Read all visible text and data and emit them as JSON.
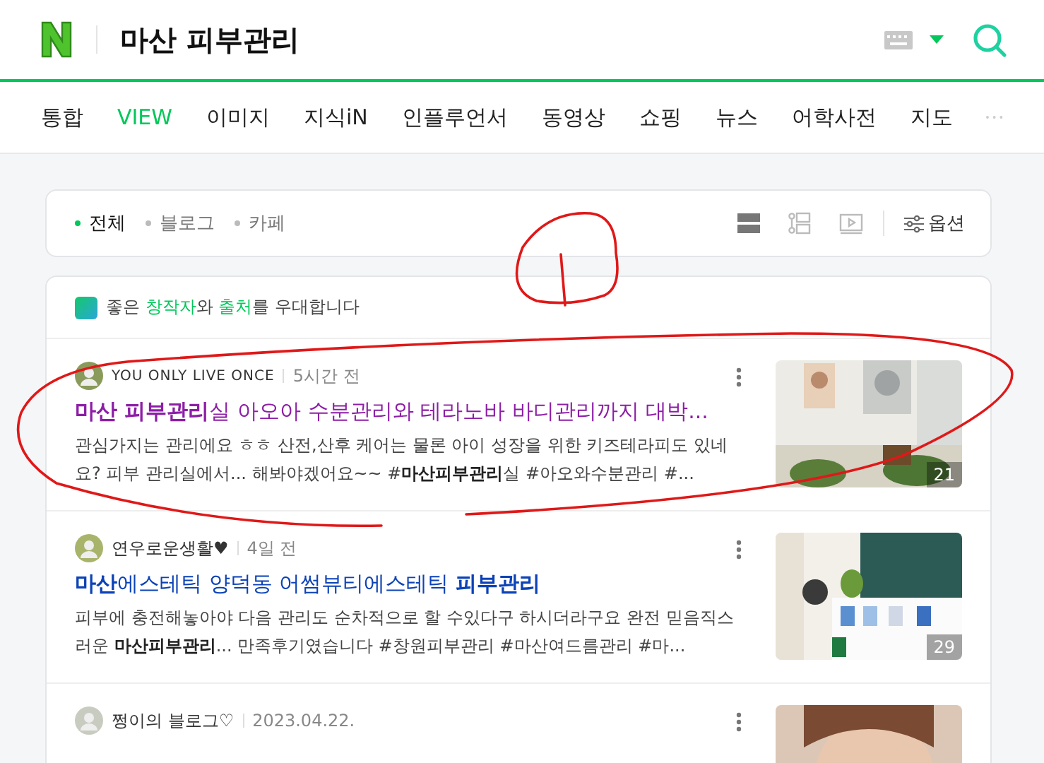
{
  "search": {
    "query": "마산 피부관리"
  },
  "tabs": [
    {
      "label": "통합",
      "selected": false
    },
    {
      "label": "VIEW",
      "selected": true
    },
    {
      "label": "이미지",
      "selected": false
    },
    {
      "label": "지식iN",
      "selected": false
    },
    {
      "label": "인플루언서",
      "selected": false
    },
    {
      "label": "동영상",
      "selected": false
    },
    {
      "label": "쇼핑",
      "selected": false
    },
    {
      "label": "뉴스",
      "selected": false
    },
    {
      "label": "어학사전",
      "selected": false
    },
    {
      "label": "지도",
      "selected": false
    }
  ],
  "filters": [
    {
      "label": "전체",
      "selected": true
    },
    {
      "label": "블로그",
      "selected": false
    },
    {
      "label": "카페",
      "selected": false
    }
  ],
  "options_label": "옵션",
  "notice": "좋은 **창작자**와 **출처**를 우대합니다",
  "results": [
    {
      "author": "YOU ONLY LIVE ONCE",
      "time": "5시간 전",
      "title": "**마산 피부관리**실 아오아 수분관리와 테라노바 바디관리까지 대박...",
      "visited": true,
      "snippet": "관심가지는 관리에요 ㅎㅎ 산전,산후 케어는 물론 아이 성장을 위한 키즈테라피도 있네요? 피부 관리실에서... 해봐야겠어요~~ #**마산피부관리**실 #아오와수분관리 #...",
      "photo_count": "21"
    },
    {
      "author": "연우로운생활♥",
      "time": "4일 전",
      "title": "**마산**에스테틱 양덕동 어썸뷰티에스테틱 **피부관리**",
      "visited": false,
      "snippet": "피부에 충전해놓아야 다음 관리도 순차적으로 할 수있다구 하시더라구요 완전 믿음직스러운 **마산피부관리**... 만족후기였습니다 #창원피부관리 #마산여드름관리 #마...",
      "photo_count": "29"
    },
    {
      "author": "쩡이의 블로그♡",
      "time": "2023.04.22."
    }
  ]
}
